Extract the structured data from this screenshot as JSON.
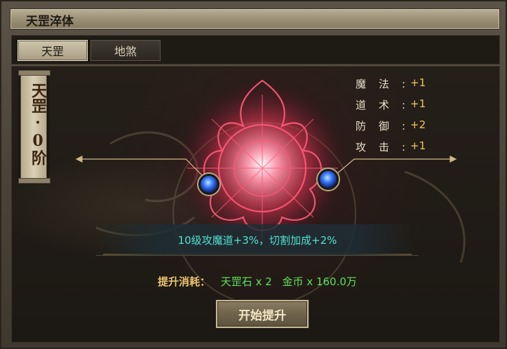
{
  "window": {
    "title": "天罡淬体"
  },
  "tabs": [
    {
      "label": "天罡",
      "active": true
    },
    {
      "label": "地煞",
      "active": false
    }
  ],
  "rank": {
    "label": "天罡·0阶"
  },
  "stats": [
    {
      "label": "魔法:",
      "value": "+1"
    },
    {
      "label": "道术:",
      "value": "+1"
    },
    {
      "label": "防御:",
      "value": "+2"
    },
    {
      "label": "攻击:",
      "value": "+1"
    }
  ],
  "bonus": {
    "text": "10级攻魔道+3%，切割加成+2%"
  },
  "cost": {
    "label": "提升消耗：",
    "items": [
      "天罡石 x 2",
      "金币 x 160.0万"
    ]
  },
  "upgrade_button": {
    "label": "开始提升"
  },
  "colors": {
    "stat_value": "#f2c85a",
    "bonus_text": "#54e0d0",
    "cost_label": "#e9c470",
    "cost_item": "#5fe05a",
    "orb": "#3a7bff",
    "sigil": "#ff5a78"
  }
}
